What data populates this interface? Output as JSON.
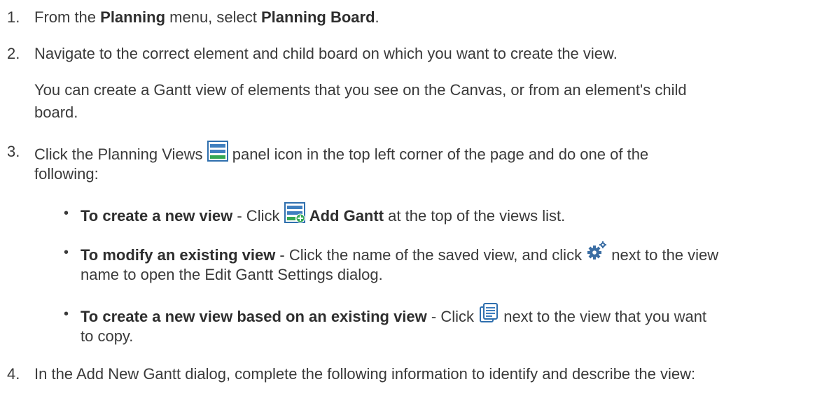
{
  "steps": [
    {
      "number": "1.",
      "parts": [
        "From the ",
        "Planning",
        " menu, select ",
        "Planning Board",
        "."
      ]
    },
    {
      "number": "2.",
      "text": "Navigate to the correct element and child board on which you want to create the view.",
      "note_line1": "You can create a Gantt view of elements that you see on the Canvas, or from an element's child",
      "note_line2": "board."
    },
    {
      "number": "3.",
      "line1_a": "Click the Planning Views ",
      "line1_b": " panel icon in the top left corner of the page and do one of the",
      "line2": "following:",
      "bullets": [
        {
          "bold": "To create a new view",
          "text_a": " - Click ",
          "bold2": "Add Gantt",
          "text_b": " at the top of the views list."
        },
        {
          "bold": "To modify an existing view",
          "text_a": " - Click the name of the saved view, and click ",
          "text_b": " next to the view",
          "line2": "name to open the Edit Gantt Settings dialog."
        },
        {
          "bold": "To create a new view based on an existing view",
          "text_a": " - Click ",
          "text_b": " next to the view that you want",
          "line2": "to copy."
        }
      ]
    },
    {
      "number": "4.",
      "text": "In the Add New Gantt dialog, complete the following information to identify and describe the view:"
    }
  ],
  "icons": {
    "planning_views": "planning-views-icon",
    "add_gantt": "add-gantt-icon",
    "settings": "gear-icon",
    "copy": "copy-view-icon"
  },
  "colors": {
    "icon_blue": "#3f7fbf",
    "icon_green": "#34a853",
    "text": "#3a3a3a"
  }
}
